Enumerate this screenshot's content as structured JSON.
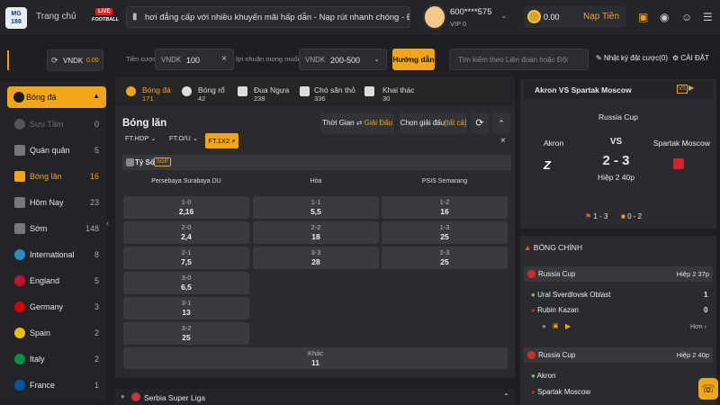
{
  "header": {
    "logo": "MG 188",
    "home": "Trang chủ",
    "live_tag": "LIVE",
    "live_sub": "FOOTBALL",
    "marquee": "hơi đẳng cấp với nhiều khuyến mãi hấp dẫn - Nạp rút nhanh chóng - Đội ngũ CSKH chu",
    "username": "600****575",
    "vip": "VIP 0",
    "balance": "0.00",
    "deposit": "Nạp Tiền"
  },
  "sidebar": {
    "currency": "VNDK",
    "currency_val": "0.00",
    "section": "Bóng đá",
    "items": [
      {
        "label": "Sưu Tầm",
        "count": "0"
      },
      {
        "label": "Quán quân",
        "count": "5"
      },
      {
        "label": "Bóng lăn",
        "count": "16"
      },
      {
        "label": "Hôm Nay",
        "count": "23"
      },
      {
        "label": "Sớm",
        "count": "148"
      },
      {
        "label": "International",
        "count": "8"
      },
      {
        "label": "England",
        "count": "5"
      },
      {
        "label": "Germany",
        "count": "3"
      },
      {
        "label": "Spain",
        "count": "2"
      },
      {
        "label": "Italy",
        "count": "2"
      },
      {
        "label": "France",
        "count": "1"
      }
    ]
  },
  "filters": {
    "bet_label": "Tiền cược",
    "bet_currency": "VNDK",
    "bet_value": "100",
    "profit_label": "lợi nhuận mong muốn",
    "profit_currency": "VNDK",
    "profit_value": "200-500",
    "guide": "Hướng dẫn",
    "search_placeholder": "Tìm kiếm theo Liên đoàn hoặc Đội",
    "log": "Nhật ký đặt cược(0)",
    "settings": "CÀI ĐẶT"
  },
  "tabs": [
    {
      "name": "Bóng đá",
      "count": "171"
    },
    {
      "name": "Bóng rổ",
      "count": "42"
    },
    {
      "name": "Đua Ngựa",
      "count": "238"
    },
    {
      "name": "Chó săn thỏ",
      "count": "336"
    },
    {
      "name": "Khai thác",
      "count": "30"
    }
  ],
  "main": {
    "title": "Bóng lăn",
    "time_btn": "Thời Gian",
    "league_btn": "Giải Đấu",
    "choose_league": "Chọn giải đấu",
    "all": "[tất cả]",
    "chips": [
      "FT.HDP",
      "FT.O/U",
      "FT.1X2"
    ],
    "score_title": "Tỷ Số",
    "sgp": "SGP",
    "col_home": "Persebaya Surabaya DU",
    "col_draw": "Hòa",
    "col_away": "PSIS Semarang",
    "home_odds": [
      [
        "1-0",
        "2,16"
      ],
      [
        "2-0",
        "2,4"
      ],
      [
        "2-1",
        "7,5"
      ],
      [
        "3-0",
        "6,5"
      ],
      [
        "3-1",
        "13"
      ],
      [
        "3-2",
        "25"
      ]
    ],
    "draw_odds": [
      [
        "1-1",
        "5,5"
      ],
      [
        "2-2",
        "18"
      ],
      [
        "3-3",
        "28"
      ]
    ],
    "away_odds": [
      [
        "1-2",
        "16"
      ],
      [
        "1-3",
        "25"
      ],
      [
        "2-3",
        "25"
      ]
    ],
    "other_label": "Khác",
    "other_odds": "11",
    "next_league": "Serbia Super Liga"
  },
  "match": {
    "title": "Akron VS Spartak Moscow",
    "league": "Russia Cup",
    "home": "Akron",
    "vs": "VS",
    "away": "Spartak Moscow",
    "score": "2 - 3",
    "period": "Hiệp 2 40p",
    "corners": "1 - 3",
    "cards": "0 - 2"
  },
  "hot": {
    "title": "BÓNG CHÍNH",
    "games": [
      {
        "league": "Russia Cup",
        "time": "Hiệp 2 37p",
        "home": "Ural Sverdlovsk Oblast",
        "home_score": "1",
        "away": "Rubin Kazan",
        "away_score": "0",
        "more": "Hơn"
      },
      {
        "league": "Russia Cup",
        "time": "Hiệp 2 40p",
        "home": "Akron",
        "home_score": "",
        "away": "Spartak Moscow",
        "away_score": ""
      }
    ]
  }
}
